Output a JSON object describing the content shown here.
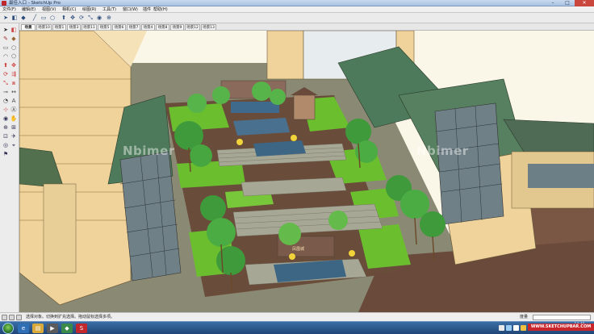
{
  "window": {
    "title": "最佳入口 - SketchUp Pro",
    "minimize": "–",
    "maximize": "□",
    "close": "✕"
  },
  "menu": [
    "文件(F)",
    "编辑(E)",
    "视图(V)",
    "相机(C)",
    "绘图(R)",
    "工具(T)",
    "窗口(W)",
    "插件",
    "帮助(H)"
  ],
  "scene_tabs": [
    "场景",
    "场景10",
    "场景1",
    "场景3",
    "场景11",
    "场景5",
    "场景6",
    "场景7",
    "场景4",
    "场景8",
    "场景9",
    "场景12",
    "场景13"
  ],
  "active_scene_tab": 0,
  "toolbar": {
    "icons": [
      "select-icon",
      "eraser-icon",
      "paint-icon",
      "line-icon",
      "rectangle-icon",
      "circle-icon",
      "push-pull-icon",
      "move-icon",
      "rotate-icon",
      "scale-icon",
      "undo-icon",
      "redo-icon",
      "orbit-icon",
      "zoom-icon"
    ]
  },
  "palette": {
    "icons": [
      "select-icon",
      "eraser-icon",
      "pencil-icon",
      "paint-icon",
      "rectangle-icon",
      "circle-icon",
      "arc-icon",
      "polygon-icon",
      "freehand-icon",
      "push-pull-icon",
      "move-icon",
      "rotate-icon",
      "follow-me-icon",
      "scale-icon",
      "offset-icon",
      "tape-icon",
      "dimension-icon",
      "protractor-icon",
      "text-icon",
      "axes-icon",
      "3d-text-icon",
      "orbit-icon",
      "pan-icon",
      "zoom-icon",
      "zoom-window-icon",
      "zoom-extents-icon",
      "walk-icon",
      "look-around-icon",
      "section-icon",
      "position-camera-icon"
    ]
  },
  "watermark": "Nbimer",
  "plaza_sign": "凤凰城",
  "status": {
    "text": "选择对象。切换到扩充选择。拖动鼠标选择多项。",
    "measure_label": "度量"
  },
  "taskbar": {
    "clock_time": "14:49",
    "clock_date": "",
    "site": "WWW.SKETCHUPBAR.COM"
  },
  "colors": {
    "grass": "#6bbf2f",
    "beige_wall": "#efd39a",
    "roof_green": "#4d7a5a",
    "glass": "#6b7f8a",
    "water": "#3f6a8c",
    "paving": "#6a4c3a",
    "stone": "#8a8a70"
  }
}
